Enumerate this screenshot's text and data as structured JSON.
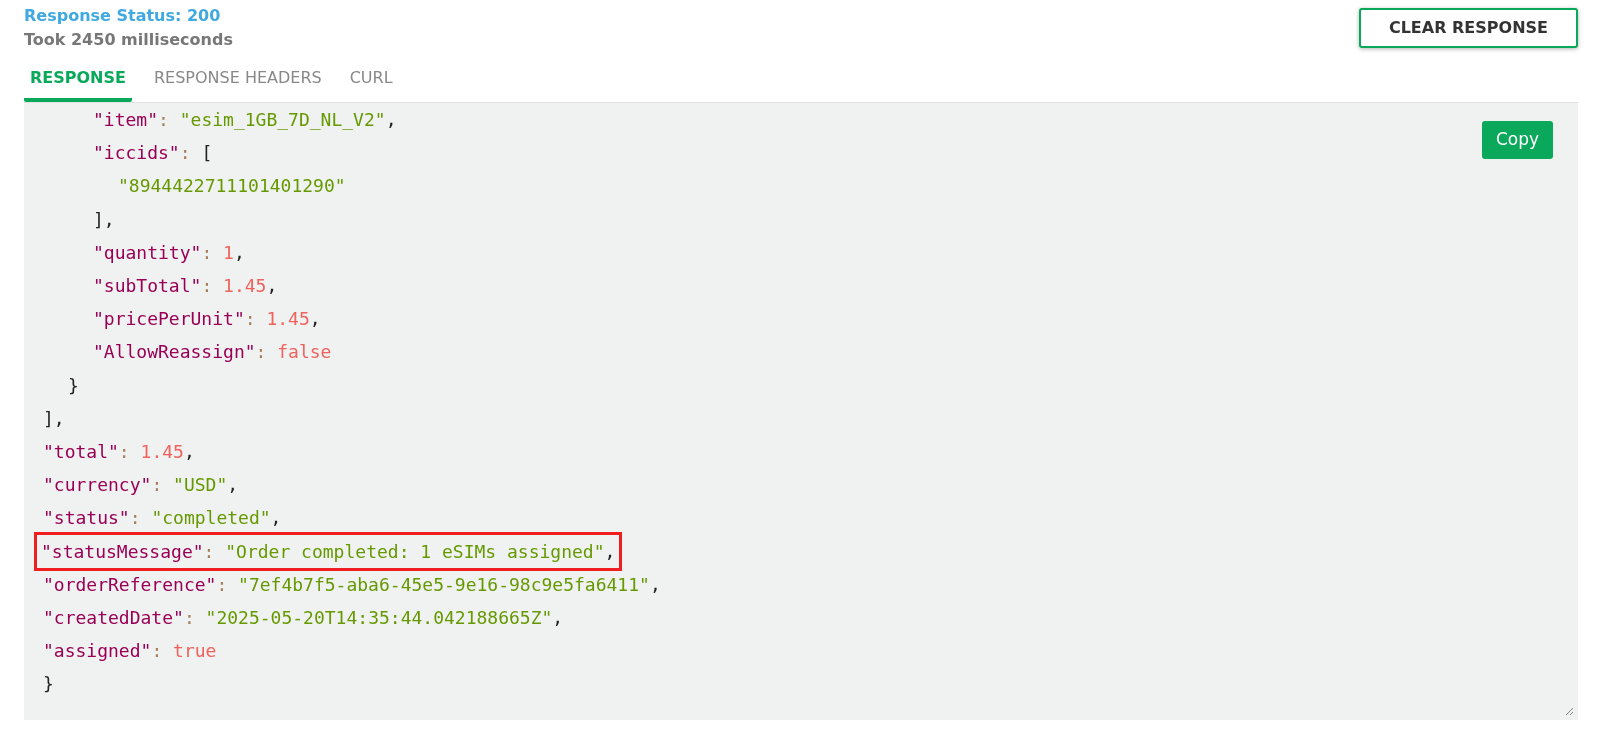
{
  "response_status": "Response Status: 200",
  "elapsed": "Took 2450 milliseconds",
  "clear_button": "CLEAR RESPONSE",
  "tabs": [
    {
      "label": "RESPONSE",
      "selected": true
    },
    {
      "label": "RESPONSE HEADERS",
      "selected": false
    },
    {
      "label": "CURL",
      "selected": false
    }
  ],
  "copy_button": "Copy",
  "code_lines": [
    {
      "children": [
        {
          "children": [
            {
              "children": [
                {
                  "highlighted": false,
                  "tokens": [
                    {
                      "kind": "key",
                      "text": "\"item\""
                    },
                    {
                      "kind": "colon",
                      "text": ": "
                    },
                    {
                      "kind": "string",
                      "text": "\"esim_1GB_7D_NL_V2\""
                    },
                    {
                      "kind": "punct",
                      "text": ","
                    }
                  ]
                },
                {
                  "highlighted": false,
                  "tokens": [
                    {
                      "kind": "key",
                      "text": "\"iccids\""
                    },
                    {
                      "kind": "colon",
                      "text": ": "
                    },
                    {
                      "kind": "punct",
                      "text": "["
                    }
                  ],
                  "children": [
                    {
                      "highlighted": false,
                      "tokens": [
                        {
                          "kind": "string",
                          "text": "\"8944422711101401290\""
                        }
                      ]
                    }
                  ]
                },
                {
                  "highlighted": false,
                  "tokens": [
                    {
                      "kind": "punct",
                      "text": "],"
                    }
                  ]
                },
                {
                  "highlighted": false,
                  "tokens": [
                    {
                      "kind": "key",
                      "text": "\"quantity\""
                    },
                    {
                      "kind": "colon",
                      "text": ": "
                    },
                    {
                      "kind": "number",
                      "text": "1"
                    },
                    {
                      "kind": "punct",
                      "text": ","
                    }
                  ]
                },
                {
                  "highlighted": false,
                  "tokens": [
                    {
                      "kind": "key",
                      "text": "\"subTotal\""
                    },
                    {
                      "kind": "colon",
                      "text": ": "
                    },
                    {
                      "kind": "number",
                      "text": "1.45"
                    },
                    {
                      "kind": "punct",
                      "text": ","
                    }
                  ]
                },
                {
                  "highlighted": false,
                  "tokens": [
                    {
                      "kind": "key",
                      "text": "\"pricePerUnit\""
                    },
                    {
                      "kind": "colon",
                      "text": ": "
                    },
                    {
                      "kind": "number",
                      "text": "1.45"
                    },
                    {
                      "kind": "punct",
                      "text": ","
                    }
                  ]
                },
                {
                  "highlighted": false,
                  "tokens": [
                    {
                      "kind": "key",
                      "text": "\"AllowReassign\""
                    },
                    {
                      "kind": "colon",
                      "text": ": "
                    },
                    {
                      "kind": "boolean",
                      "text": "false"
                    }
                  ]
                }
              ]
            },
            {
              "highlighted": false,
              "tokens": [
                {
                  "kind": "punct",
                  "text": "}"
                }
              ]
            }
          ]
        },
        {
          "highlighted": false,
          "tokens": [
            {
              "kind": "punct",
              "text": "],"
            }
          ]
        },
        {
          "highlighted": false,
          "tokens": [
            {
              "kind": "key",
              "text": "\"total\""
            },
            {
              "kind": "colon",
              "text": ": "
            },
            {
              "kind": "number",
              "text": "1.45"
            },
            {
              "kind": "punct",
              "text": ","
            }
          ]
        },
        {
          "highlighted": false,
          "tokens": [
            {
              "kind": "key",
              "text": "\"currency\""
            },
            {
              "kind": "colon",
              "text": ": "
            },
            {
              "kind": "string",
              "text": "\"USD\""
            },
            {
              "kind": "punct",
              "text": ","
            }
          ]
        },
        {
          "highlighted": false,
          "tokens": [
            {
              "kind": "key",
              "text": "\"status\""
            },
            {
              "kind": "colon",
              "text": ": "
            },
            {
              "kind": "string",
              "text": "\"completed\""
            },
            {
              "kind": "punct",
              "text": ","
            }
          ]
        },
        {
          "highlighted": true,
          "tokens": [
            {
              "kind": "key",
              "text": "\"statusMessage\""
            },
            {
              "kind": "colon",
              "text": ": "
            },
            {
              "kind": "string",
              "text": "\"Order completed: 1 eSIMs assigned\""
            },
            {
              "kind": "punct",
              "text": ","
            }
          ]
        },
        {
          "highlighted": false,
          "tokens": [
            {
              "kind": "key",
              "text": "\"orderReference\""
            },
            {
              "kind": "colon",
              "text": ": "
            },
            {
              "kind": "string",
              "text": "\"7ef4b7f5-aba6-45e5-9e16-98c9e5fa6411\""
            },
            {
              "kind": "punct",
              "text": ","
            }
          ]
        },
        {
          "highlighted": false,
          "tokens": [
            {
              "kind": "key",
              "text": "\"createdDate\""
            },
            {
              "kind": "colon",
              "text": ": "
            },
            {
              "kind": "string",
              "text": "\"2025-05-20T14:35:44.042188665Z\""
            },
            {
              "kind": "punct",
              "text": ","
            }
          ]
        },
        {
          "highlighted": false,
          "tokens": [
            {
              "kind": "key",
              "text": "\"assigned\""
            },
            {
              "kind": "colon",
              "text": ": "
            },
            {
              "kind": "boolean",
              "text": "true"
            }
          ]
        }
      ]
    },
    {
      "highlighted": false,
      "tokens": [
        {
          "kind": "punct",
          "text": "}"
        }
      ]
    }
  ]
}
